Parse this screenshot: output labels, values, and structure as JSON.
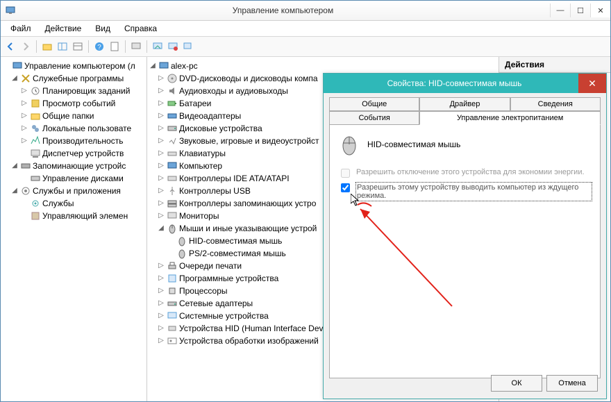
{
  "window": {
    "title": "Управление компьютером",
    "menus": [
      "Файл",
      "Действие",
      "Вид",
      "Справка"
    ]
  },
  "actions_panel": {
    "header": "Действия"
  },
  "left_tree": {
    "root": "Управление компьютером (л",
    "sys_tools": "Служебные программы",
    "sys_children": [
      "Планировщик заданий",
      "Просмотр событий",
      "Общие папки",
      "Локальные пользовате",
      "Производительность",
      "Диспетчер устройств"
    ],
    "storage": "Запоминающие устройс",
    "storage_children": [
      "Управление дисками"
    ],
    "services": "Службы и приложения",
    "services_children": [
      "Службы",
      "Управляющий элемен"
    ]
  },
  "mid_tree": {
    "root": "alex-pc",
    "items": [
      "DVD-дисководы и дисководы компа",
      "Аудиовходы и аудиовыходы",
      "Батареи",
      "Видеоадаптеры",
      "Дисковые устройства",
      "Звуковые, игровые и видеоустройст",
      "Клавиатуры",
      "Компьютер",
      "Контроллеры IDE ATA/ATAPI",
      "Контроллеры USB",
      "Контроллеры запоминающих устро",
      "Мониторы"
    ],
    "mice": "Мыши и иные указывающие устрой",
    "mice_children": [
      "HID-совместимая мышь",
      "PS/2-совместимая мышь"
    ],
    "after_mice": [
      "Очереди печати",
      "Программные устройства",
      "Процессоры",
      "Сетевые адаптеры",
      "Системные устройства",
      "Устройства HID (Human Interface Dev",
      "Устройства обработки изображений"
    ]
  },
  "dialog": {
    "title": "Свойства: HID-совместимая мышь",
    "tabs": {
      "general": "Общие",
      "driver": "Драйвер",
      "details": "Сведения",
      "events": "События",
      "power": "Управление электропитанием"
    },
    "device_name": "HID-совместимая мышь",
    "cb1": "Разрешить отключение этого устройства для экономии энергии.",
    "cb2": "Разрешить этому устройству выводить компьютер из ждущего режима.",
    "ok": "ОК",
    "cancel": "Отмена"
  }
}
